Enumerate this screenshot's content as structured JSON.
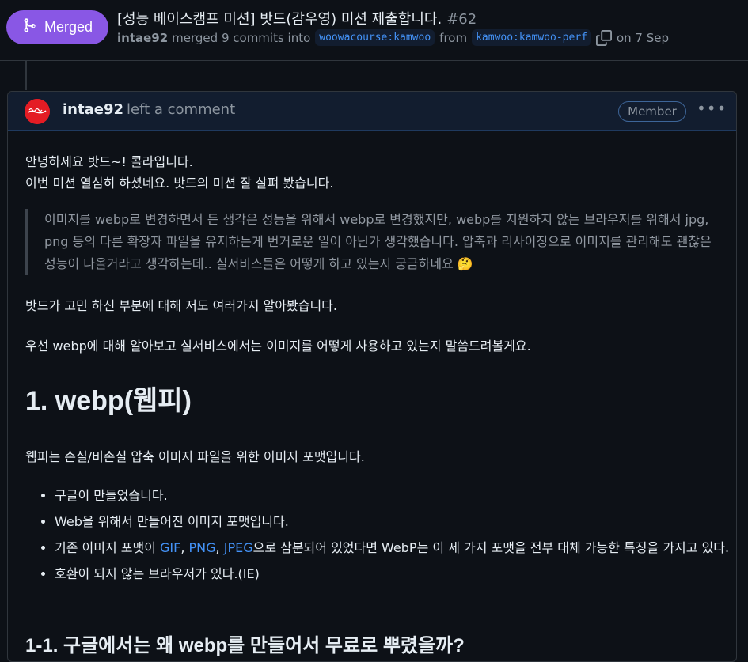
{
  "header": {
    "badge_label": "Merged",
    "title": "[성능 베이스캠프 미션] 밧드(감우영) 미션 제출합니다.",
    "number": "#62",
    "author": "intae92",
    "merged_text": "merged 9 commits into",
    "base_branch": "woowacourse:kamwoo",
    "from_text": "from",
    "head_branch": "kamwoo:kamwoo-perf",
    "date_text": "on 7 Sep",
    "colors": {
      "merged": "#8957e5",
      "link": "#4493f8"
    }
  },
  "comment": {
    "author": "intae92",
    "action": "left a comment",
    "role_badge": "Member",
    "menu_icon": "kebab-horizontal-icon",
    "greeting_1": "안녕하세요 밧드~! 콜라입니다.",
    "greeting_2": "이번 미션 열심히 하셨네요. 밧드의 미션 잘 살펴 봤습니다.",
    "quote": "이미지를 webp로 변경하면서 든 생각은 성능을 위해서 webp로 변경했지만, webp를 지원하지 않는 브라우저를 위해서 jpg, png 등의 다른 확장자 파일을 유지하는게 번거로운 일이 아닌가 생각했습니다. 압축과 리사이징으로 이미지를 관리해도 괜찮은 성능이 나올거라고 생각하는데.. 실서비스들은 어떻게 하고 있는지 궁금하네요",
    "quote_emoji": "🤔",
    "para_1": "밧드가 고민 하신 부분에 대해 저도 여러가지 알아봤습니다.",
    "para_2": "우선 webp에 대해 알아보고 실서비스에서는 이미지를 어떻게 사용하고 있는지 말씀드려볼게요.",
    "heading_1": "1. webp(웹피)",
    "para_3": "웹피는 손실/비손실 압축 이미지 파일을 위한 이미지 포맷입니다.",
    "bullets": {
      "b1": "구글이 만들었습니다.",
      "b2": "Web을 위해서 만들어진 이미지 포맷입니다.",
      "b3_prefix": "기존 이미지 포맷이 ",
      "b3_gif": "GIF",
      "b3_sep1": ", ",
      "b3_png": "PNG",
      "b3_sep2": ", ",
      "b3_jpeg": "JPEG",
      "b3_suffix": "으로 삼분되어 있었다면 WebP는 이 세 가지 포맷을 전부 대체 가능한 특징을 가지고 있다.",
      "b4": "호환이 되지 않는 브라우저가 있다.(IE)"
    },
    "heading_2": "1-1. 구글에서는 왜 webp를 만들어서 무료로 뿌렸을까?"
  }
}
